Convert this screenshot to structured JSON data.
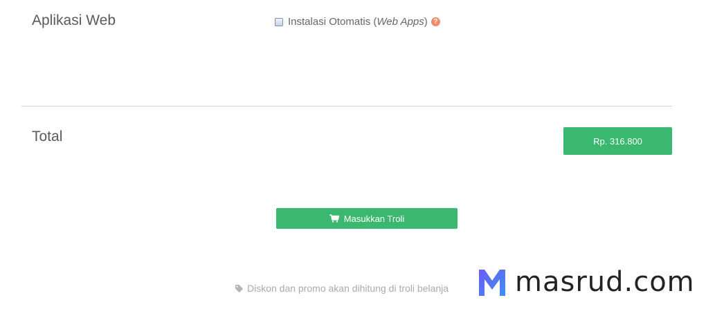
{
  "webapps": {
    "title": "Aplikasi Web",
    "auto_install_prefix": "Instalasi Otomatis (",
    "auto_install_italic": "Web Apps",
    "auto_install_suffix": ")",
    "help_symbol": "?",
    "checked": false
  },
  "total": {
    "title": "Total",
    "price_label": "Rp. 316.800"
  },
  "cart_button": {
    "label": "Masukkan Troli",
    "icon": "cart-icon"
  },
  "discount_note": {
    "text": "Diskon dan promo akan dihitung di troli belanja",
    "icon": "tag-icon"
  },
  "watermark": {
    "text": "masrud.com"
  },
  "colors": {
    "accent_green": "#3ab86f",
    "help_orange": "#f08c6d"
  }
}
